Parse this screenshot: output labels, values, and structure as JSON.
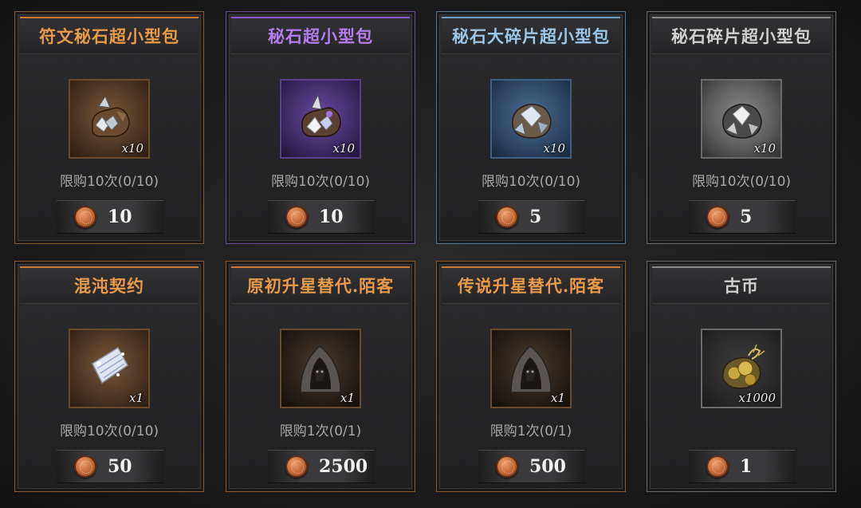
{
  "shop": {
    "items": [
      {
        "title": "符文秘石超小型包",
        "rarity": "orange",
        "quantity": "x10",
        "limit": "限购10次(0/10)",
        "price": "10",
        "icon": "runestone-pack-icon"
      },
      {
        "title": "秘石超小型包",
        "rarity": "purple",
        "quantity": "x10",
        "limit": "限购10次(0/10)",
        "price": "10",
        "icon": "arcane-stone-pack-icon"
      },
      {
        "title": "秘石大碎片超小型包",
        "rarity": "blue",
        "quantity": "x10",
        "limit": "限购10次(0/10)",
        "price": "5",
        "icon": "large-shard-pack-icon"
      },
      {
        "title": "秘石碎片超小型包",
        "rarity": "gray",
        "quantity": "x10",
        "limit": "限购10次(0/10)",
        "price": "5",
        "icon": "shard-pack-icon"
      },
      {
        "title": "混沌契约",
        "rarity": "orange",
        "quantity": "x1",
        "limit": "限购10次(0/10)",
        "price": "50",
        "icon": "chaos-contract-icon"
      },
      {
        "title": "原初升星替代.陌客",
        "rarity": "orange",
        "quantity": "x1",
        "limit": "限购1次(0/1)",
        "price": "2500",
        "icon": "hooded-stranger-icon"
      },
      {
        "title": "传说升星替代.陌客",
        "rarity": "orange",
        "quantity": "x1",
        "limit": "限购1次(0/1)",
        "price": "500",
        "icon": "hooded-stranger-icon"
      },
      {
        "title": "古币",
        "rarity": "gray",
        "quantity": "x1000",
        "limit": "",
        "price": "1",
        "icon": "ancient-coin-icon"
      }
    ],
    "currency_icon": "mooncake-coin-icon",
    "colors": {
      "orange": "#e89a4a",
      "purple": "#b57cf0",
      "blue": "#9cc6e6",
      "gray": "#d0d0d0"
    }
  }
}
